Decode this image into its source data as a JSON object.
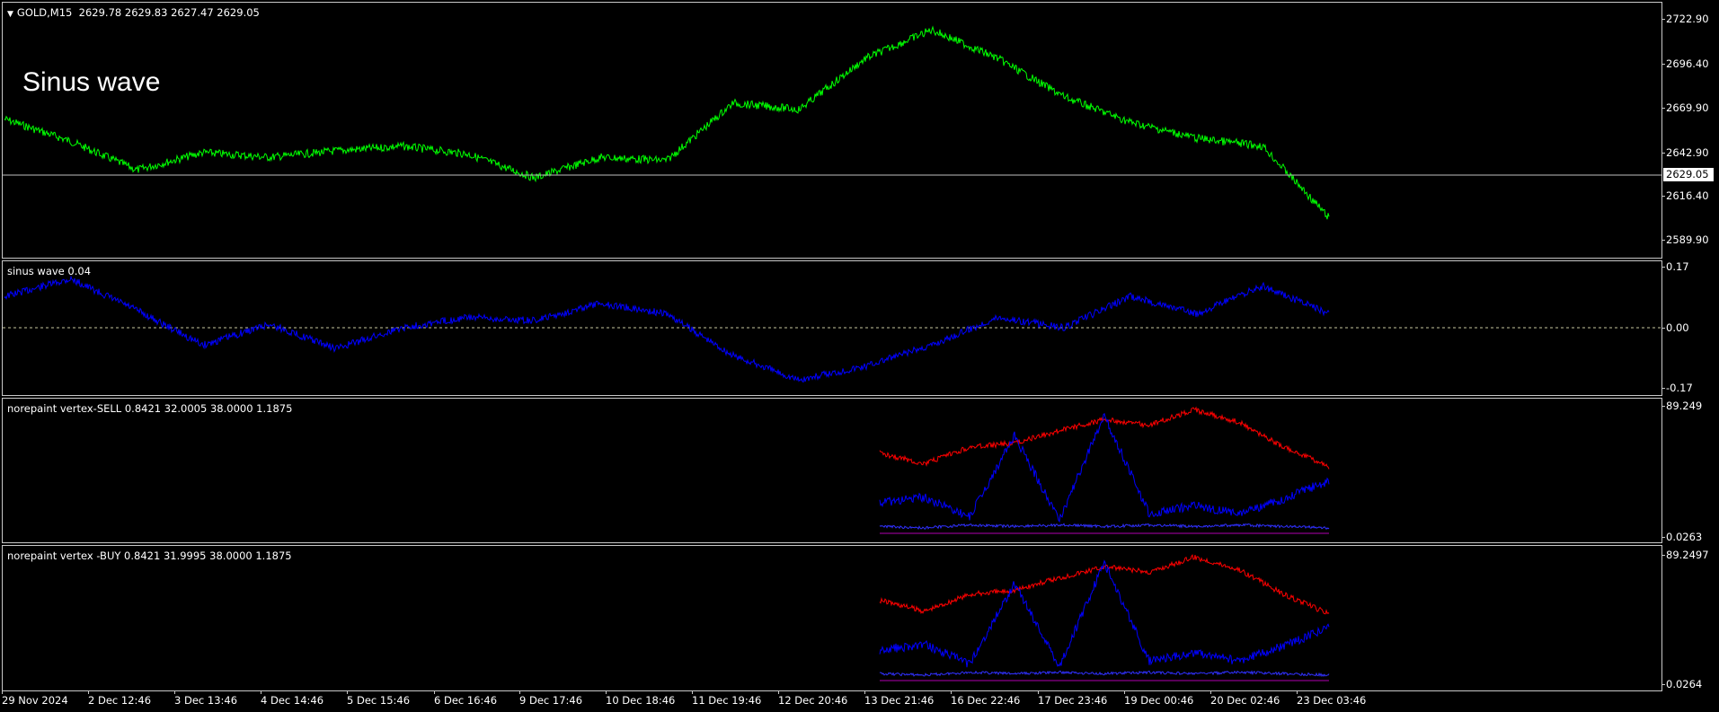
{
  "main_pane": {
    "header": "GOLD,M15  2629.78 2629.83 2627.47 2629.05",
    "overlay_title": "Sinus wave",
    "price_ticks": [
      "2722.90",
      "2696.40",
      "2669.90",
      "2642.90",
      "2616.40",
      "2589.90"
    ],
    "current_price": "2629.05",
    "line_color": "#00ff00"
  },
  "sinus_pane": {
    "header": "sinus wave 0.04",
    "ticks": [
      "0.17",
      "0.00",
      "-0.17"
    ],
    "line_color": "#0000ff"
  },
  "sell_pane": {
    "header": "norepaint vertex-SELL 0.8421 32.0005 38.0000 1.1875",
    "ticks": [
      "89.249",
      "0.0263"
    ]
  },
  "buy_pane": {
    "header": "norepaint vertex -BUY 0.8421 31.9995 38.0000 1.1875",
    "ticks": [
      "89.2497",
      "0.0264"
    ]
  },
  "time_axis": [
    "29 Nov 2024",
    "2 Dec 12:46",
    "3 Dec 13:46",
    "4 Dec 14:46",
    "5 Dec 15:46",
    "6 Dec 16:46",
    "9 Dec 17:46",
    "10 Dec 18:46",
    "11 Dec 19:46",
    "12 Dec 20:46",
    "13 Dec 21:46",
    "16 Dec 22:46",
    "17 Dec 23:46",
    "19 Dec 00:46",
    "20 Dec 02:46",
    "23 Dec 03:46"
  ],
  "chart_data": [
    {
      "type": "line",
      "title": "GOLD,M15",
      "ylim": [
        2575,
        2735
      ],
      "series": [
        {
          "name": "GOLD,M15",
          "x": [
            0,
            5,
            10,
            15,
            20,
            25,
            30,
            35,
            40,
            45,
            50,
            55,
            60,
            65,
            70,
            75,
            80,
            85,
            90,
            95,
            100
          ],
          "values": [
            2662,
            2648,
            2630,
            2641,
            2638,
            2642,
            2645,
            2640,
            2625,
            2638,
            2636,
            2672,
            2668,
            2700,
            2718,
            2700,
            2676,
            2660,
            2650,
            2645,
            2600
          ]
        }
      ]
    },
    {
      "type": "line",
      "title": "sinus wave 0.04",
      "ylim": [
        -0.17,
        0.17
      ],
      "series": [
        {
          "name": "sinus wave",
          "x": [
            0,
            5,
            10,
            15,
            20,
            25,
            30,
            35,
            40,
            45,
            50,
            55,
            60,
            65,
            70,
            75,
            80,
            85,
            90,
            95,
            100
          ],
          "values": [
            0.09,
            0.14,
            0.05,
            -0.05,
            0.01,
            -0.06,
            0.0,
            0.03,
            0.02,
            0.07,
            0.04,
            -0.08,
            -0.15,
            -0.11,
            -0.05,
            0.03,
            0.0,
            0.09,
            0.04,
            0.12,
            0.04
          ]
        }
      ]
    },
    {
      "type": "line",
      "title": "norepaint vertex-SELL 0.8421 32.0005 38.0000 1.1875",
      "ylim": [
        0.0263,
        89.249
      ],
      "series": [
        {
          "name": "red",
          "x": [
            0,
            10,
            20,
            30,
            40,
            50,
            60,
            70,
            80,
            90,
            100
          ],
          "values": [
            58,
            50,
            62,
            65,
            74,
            82,
            78,
            89,
            80,
            62,
            48
          ]
        },
        {
          "name": "blue",
          "x": [
            0,
            10,
            20,
            30,
            40,
            50,
            60,
            70,
            80,
            90,
            100
          ],
          "values": [
            22,
            26,
            12,
            70,
            10,
            85,
            14,
            20,
            14,
            25,
            38
          ]
        },
        {
          "name": "blue-lower",
          "x": [
            0,
            10,
            20,
            30,
            40,
            50,
            60,
            70,
            80,
            90,
            100
          ],
          "values": [
            5,
            4,
            6,
            5,
            6,
            5,
            6,
            5,
            6,
            5,
            4
          ]
        }
      ]
    },
    {
      "type": "line",
      "title": "norepaint vertex -BUY 0.8421 31.9995 38.0000 1.1875",
      "ylim": [
        0.0264,
        89.2497
      ],
      "series": [
        {
          "name": "red",
          "x": [
            0,
            10,
            20,
            30,
            40,
            50,
            60,
            70,
            80,
            90,
            100
          ],
          "values": [
            58,
            50,
            62,
            65,
            74,
            82,
            78,
            89,
            80,
            62,
            48
          ]
        },
        {
          "name": "blue",
          "x": [
            0,
            10,
            20,
            30,
            40,
            50,
            60,
            70,
            80,
            90,
            100
          ],
          "values": [
            22,
            26,
            12,
            70,
            10,
            85,
            14,
            20,
            14,
            25,
            38
          ]
        },
        {
          "name": "blue-lower",
          "x": [
            0,
            10,
            20,
            30,
            40,
            50,
            60,
            70,
            80,
            90,
            100
          ],
          "values": [
            5,
            4,
            6,
            5,
            6,
            5,
            6,
            5,
            6,
            5,
            4
          ]
        }
      ]
    }
  ]
}
